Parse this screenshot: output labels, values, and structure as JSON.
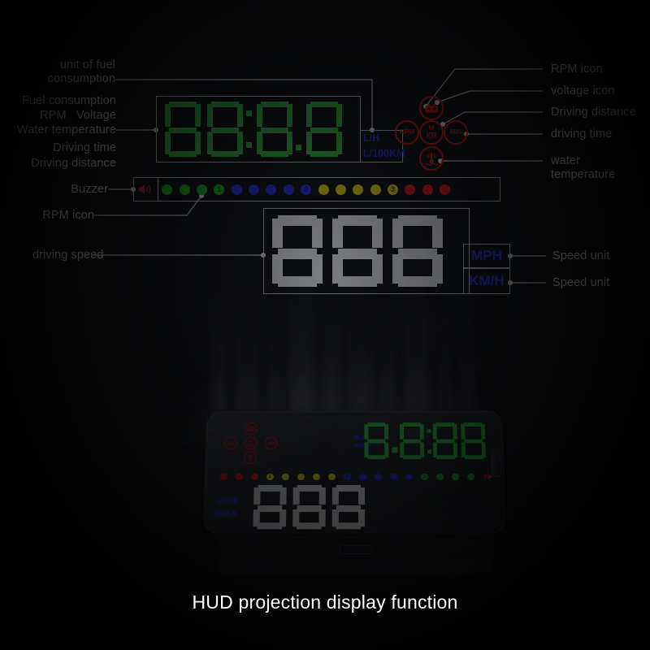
{
  "caption": "HUD projection display function",
  "labels_left": [
    {
      "id": "unit-of-fuel-consumption",
      "text": "unit of fuel\nconsumption"
    },
    {
      "id": "fuel-consumption",
      "text": "Fuel consumption"
    },
    {
      "id": "rpm-voltage",
      "text": "RPM   Voltage"
    },
    {
      "id": "water-temperature",
      "text": "Water temperature"
    },
    {
      "id": "driving-time",
      "text": "Driving time"
    },
    {
      "id": "driving-distance",
      "text": "Driving distance"
    },
    {
      "id": "buzzer",
      "text": "Buzzer"
    },
    {
      "id": "rpm-icon",
      "text": "RPM icon"
    },
    {
      "id": "driving-speed",
      "text": "driving speed"
    }
  ],
  "labels_right": [
    {
      "id": "rpm-icon",
      "text": "RPM icon"
    },
    {
      "id": "voltage-icon",
      "text": "voltage icon"
    },
    {
      "id": "driving-distance",
      "text": "Driving distance"
    },
    {
      "id": "driving-time",
      "text": "driving time"
    },
    {
      "id": "water-temperature",
      "text": "water\ntemperature"
    },
    {
      "id": "speed-unit-mph",
      "text": "Speed unit"
    },
    {
      "id": "speed-unit-kmh",
      "text": "Speed unit"
    }
  ],
  "display": {
    "fuel_value": "88:88",
    "fuel_digits": [
      "8",
      "8",
      "8",
      "8"
    ],
    "fuel_separator": "colon",
    "fuel_decimal_point": true,
    "fuel_units": [
      "L/H",
      "L/100KM"
    ],
    "speed_value": "888",
    "speed_digits": [
      "8",
      "8",
      "8"
    ],
    "speed_units": {
      "mph": "MPH",
      "kmh": "KM/H"
    },
    "buzzer_icon": "speaker-icon"
  },
  "telltales": [
    {
      "id": "voltage",
      "glyph": "battery-icon",
      "label": ""
    },
    {
      "id": "rpm",
      "glyph": "text",
      "label": "RPM"
    },
    {
      "id": "distance",
      "glyph": "fraction",
      "label": "M",
      "label2": "KM"
    },
    {
      "id": "time",
      "glyph": "text",
      "label": "MIN"
    },
    {
      "id": "water-temp",
      "glyph": "thermometer-icon",
      "label": ""
    }
  ],
  "led_bar": {
    "groups": [
      {
        "color": "#19c419",
        "count": 4,
        "marker_index": 3,
        "marker": "1",
        "marker_text_color": "#063a06"
      },
      {
        "color": "#1f27ef",
        "count": 5,
        "marker_index": 4,
        "marker": "2",
        "marker_text_color": "#05084a"
      },
      {
        "color": "#f2e30d",
        "count": 5,
        "marker_index": 4,
        "marker": "3",
        "marker_text_color": "#3a3402"
      },
      {
        "color": "#ef1010",
        "count": 3,
        "marker_index": -1,
        "marker": "",
        "marker_text_color": "#000000"
      }
    ]
  },
  "colors": {
    "green_segment": "#2fc94a",
    "white_segment": "#f4f5f7",
    "blue_text": "#1b2cf0",
    "red_icon": "#e01010",
    "panel_border": "#c9ccd2",
    "background": "#000000"
  }
}
